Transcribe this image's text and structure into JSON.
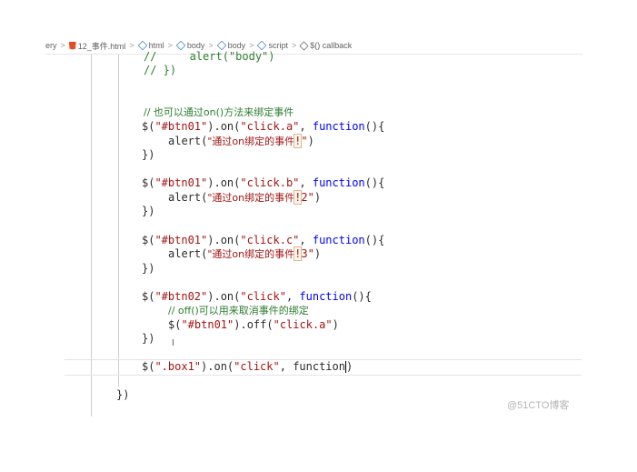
{
  "breadcrumb": {
    "items": [
      "ery",
      "12_事件.html",
      "html",
      "body",
      "body",
      "script",
      "$() callback"
    ],
    "separator": ">"
  },
  "code": {
    "l1_comment": "//     ",
    "l1_fn": "alert(",
    "l1_str": "\"body\"",
    "l1_end": ")",
    "l2": "// })",
    "l3_comment": "// 也可以通过on()方法来绑定事件",
    "b1_sel_open": "$(",
    "b1_sel_str": "\"#btn01\"",
    "b1_on": ").on(",
    "b1_evt": "\"click.a\"",
    "b1_comma": ", ",
    "b1_kw": "function",
    "b1_tail": "(){",
    "b1_alert": "alert(",
    "b1_msg": "\"通过on绑定的事件",
    "b1_bang": "!",
    "b1_msg_end": "\"",
    "b1_alert_end": ")",
    "b1_close": "})",
    "b2_sel_str": "\"#btn01\"",
    "b2_evt": "\"click.b\"",
    "b2_msg": "\"通过on绑定的事件",
    "b2_bang": "!",
    "b2_msg_end": "2\"",
    "b3_sel_str": "\"#btn01\"",
    "b3_evt": "\"click.c\"",
    "b3_msg": "\"通过on绑定的事件",
    "b3_bang": "!",
    "b3_msg_end": "3\"",
    "b4_sel_str": "\"#btn02\"",
    "b4_evt": "\"click\"",
    "b4_comment": "// off()可以用来取消事件的绑定",
    "b4_off_open": "$(",
    "b4_off_sel": "\"#btn01\"",
    "b4_off_mid": ").off(",
    "b4_off_evt": "\"click.a\"",
    "b4_off_end": ")",
    "b5_sel_str": "\".box1\"",
    "b5_on": ").on(",
    "b5_evt": "\"click\"",
    "b5_comma": ", ",
    "b5_fn": "function",
    "b5_end": ")",
    "outer_close": "})"
  },
  "cursor_glyph": "I",
  "watermark": "@51CTO博客",
  "colors": {
    "comment": "#2e7d32",
    "string": "#a31515",
    "keyword": "#0000ff",
    "text": "#2b2b2b"
  }
}
